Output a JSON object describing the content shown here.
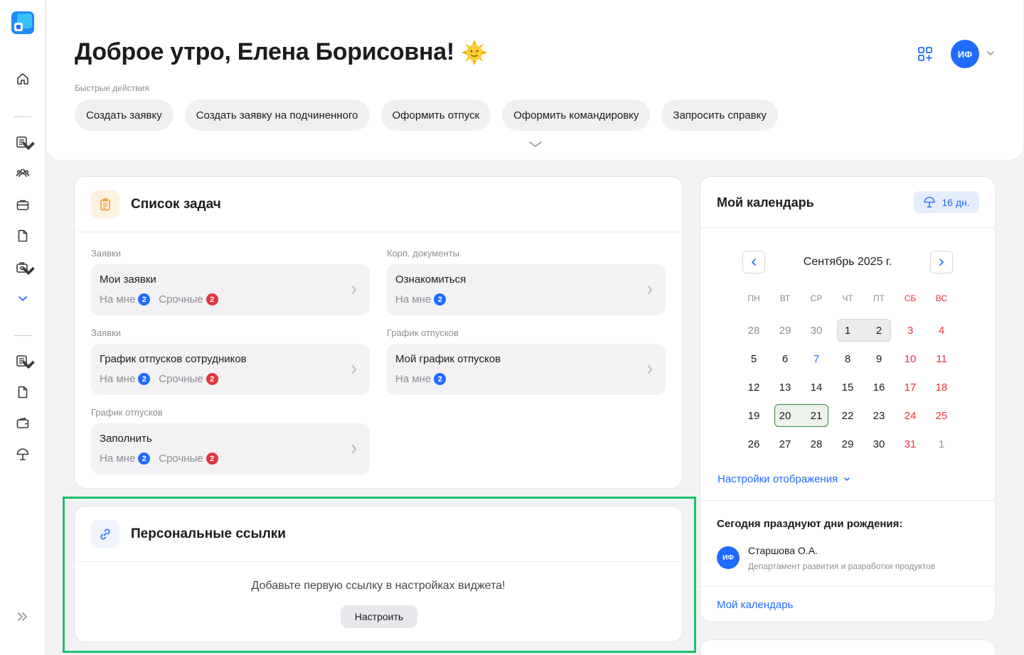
{
  "header": {
    "greeting": "Доброе утро, Елена Борисовна!",
    "quick_actions_label": "Быстрые действия",
    "quick_actions": [
      "Создать заявку",
      "Создать заявку на подчиненного",
      "Оформить отпуск",
      "Оформить командировку",
      "Запросить справку"
    ],
    "user_initials": "ИФ"
  },
  "tasks": {
    "title": "Список задач",
    "groups": [
      {
        "label": "Заявки",
        "title": "Мои заявки",
        "me_label": "На мне",
        "me_count": "2",
        "urgent_label": "Срочные",
        "urgent_count": "2"
      },
      {
        "label": "Корп. документы",
        "title": "Ознакомиться",
        "me_label": "На мне",
        "me_count": "2"
      },
      {
        "label": "Заявки",
        "title": "График отпусков сотрудников",
        "me_label": "На мне",
        "me_count": "2",
        "urgent_label": "Срочные",
        "urgent_count": "2"
      },
      {
        "label": "График отпусков",
        "title": "Мой график отпусков",
        "me_label": "На мне",
        "me_count": "2"
      },
      {
        "label": "График отпусков",
        "title": "Заполнить",
        "me_label": "На мне",
        "me_count": "2",
        "urgent_label": "Срочные",
        "urgent_count": "2"
      }
    ]
  },
  "links": {
    "title": "Персональные ссылки",
    "empty_text": "Добавьте первую ссылку в настройках виджета!",
    "button": "Настроить"
  },
  "calendar": {
    "title": "Мой календарь",
    "vacation_days": "16 дн.",
    "month": "Сентябрь 2025 г.",
    "weekdays": [
      "ПН",
      "ВТ",
      "СР",
      "ЧТ",
      "ПТ",
      "СБ",
      "ВС"
    ],
    "weeks": [
      [
        "28",
        "29",
        "30",
        "1",
        "2",
        "3",
        "4"
      ],
      [
        "5",
        "6",
        "7",
        "8",
        "9",
        "10",
        "11"
      ],
      [
        "12",
        "13",
        "14",
        "15",
        "16",
        "17",
        "18"
      ],
      [
        "19",
        "20",
        "21",
        "22",
        "23",
        "24",
        "25"
      ],
      [
        "26",
        "27",
        "28",
        "29",
        "30",
        "31",
        "1"
      ]
    ],
    "settings_link": "Настройки отображения",
    "birthday_title": "Сегодня празднуют дни рождения:",
    "birthday_person": {
      "initials": "ИФ",
      "name": "Старшова О.А.",
      "department": "Департамент развития и разработки продуктов"
    },
    "footer_link": "Мой календарь"
  },
  "colors": {
    "accent": "#1f6bff",
    "danger": "#e0373d",
    "highlight": "#1fbf6a"
  }
}
